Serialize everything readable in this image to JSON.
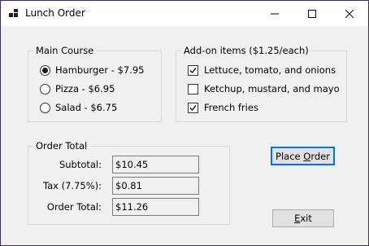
{
  "window": {
    "title": "Lunch Order",
    "app_icon": "winforms-icon",
    "controls": [
      "minimize-icon",
      "maximize-icon",
      "close-icon"
    ]
  },
  "main_course": {
    "legend": "Main Course",
    "options": [
      {
        "label": "Hamburger - $7.95",
        "selected": true
      },
      {
        "label": "Pizza - $6.95",
        "selected": false
      },
      {
        "label": "Salad - $6.75",
        "selected": false
      }
    ]
  },
  "addons": {
    "legend": "Add-on items ($1.25/each)",
    "items": [
      {
        "label": "Lettuce, tomato, and onions",
        "checked": true
      },
      {
        "label": "Ketchup, mustard, and mayo",
        "checked": false
      },
      {
        "label": "French fries",
        "checked": true
      }
    ]
  },
  "order_total": {
    "legend": "Order Total",
    "subtotal_label": "Subtotal:",
    "subtotal_value": "$10.45",
    "tax_label": "Tax (7.75%):",
    "tax_value": "$0.81",
    "total_label": "Order Total:",
    "total_value": "$11.26"
  },
  "buttons": {
    "place_order_pre": "Place ",
    "place_order_mnemonic": "O",
    "place_order_post": "rder",
    "exit_mnemonic": "E",
    "exit_post": "xit"
  },
  "colors": {
    "window_bg": "#f0f0f0",
    "titlebar_bg": "#ffffff",
    "default_button_border": "#0078d7",
    "window_border": "#3a2e55"
  }
}
